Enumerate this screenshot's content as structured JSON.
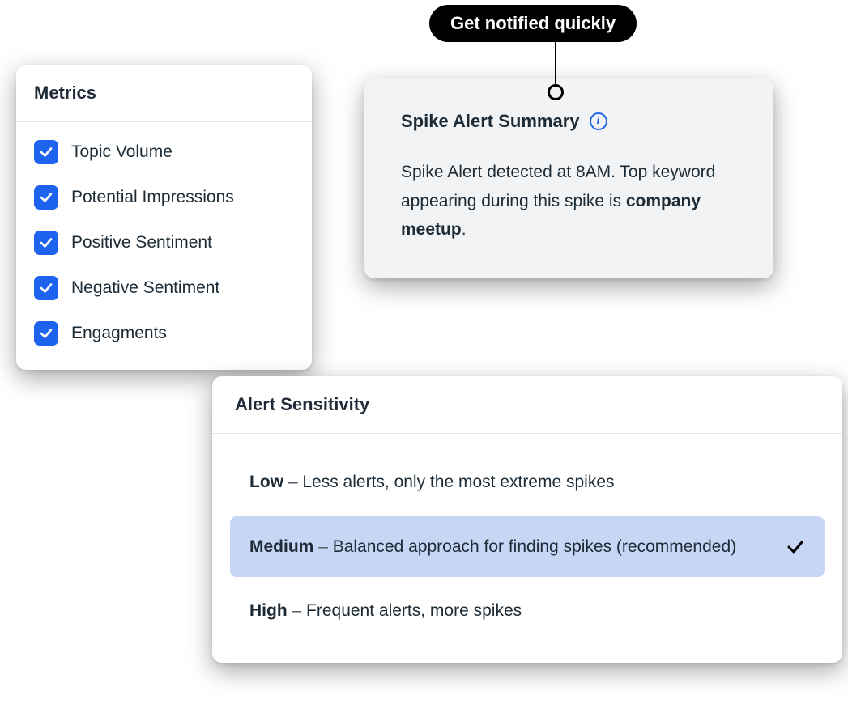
{
  "callout": {
    "label": "Get notified quickly"
  },
  "metrics": {
    "title": "Metrics",
    "items": [
      {
        "label": "Topic Volume",
        "checked": true
      },
      {
        "label": "Potential Impressions",
        "checked": true
      },
      {
        "label": "Positive Sentiment",
        "checked": true
      },
      {
        "label": "Negative Sentiment",
        "checked": true
      },
      {
        "label": "Engagments",
        "checked": true
      }
    ]
  },
  "summary": {
    "title": "Spike Alert Summary",
    "body_prefix": "Spike Alert detected at 8AM. Top keyword appearing during this spike is ",
    "body_keyword": "company meetup",
    "body_suffix": "."
  },
  "sensitivity": {
    "title": "Alert Sensitivity",
    "options": [
      {
        "name": "Low",
        "desc": "Less alerts, only the most extreme spikes",
        "selected": false
      },
      {
        "name": "Medium",
        "desc": "Balanced approach for finding spikes (recommended)",
        "selected": true
      },
      {
        "name": "High",
        "desc": "Frequent alerts, more spikes",
        "selected": false
      }
    ]
  }
}
